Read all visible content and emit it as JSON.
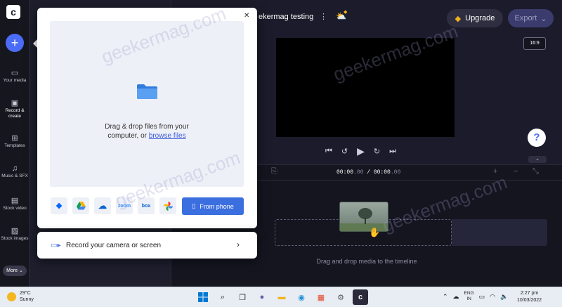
{
  "app": {
    "logo": "c",
    "project_name": "ekermag testing",
    "upgrade_label": "Upgrade",
    "export_label": "Export",
    "aspect_ratio": "16:9",
    "help": "?"
  },
  "sidebar": {
    "more_label": "More",
    "items": [
      {
        "label": "Your media",
        "icon": "folder-icon"
      },
      {
        "label": "Record & create",
        "icon": "camera-icon"
      },
      {
        "label": "Templates",
        "icon": "templates-icon"
      },
      {
        "label": "Music & SFX",
        "icon": "music-icon"
      },
      {
        "label": "Stock video",
        "icon": "film-icon"
      },
      {
        "label": "Stock images",
        "icon": "image-icon"
      }
    ]
  },
  "popup": {
    "drop_text": "Drag & drop files from your computer, or",
    "drop_line1": "Drag & drop files from your",
    "drop_line2": "computer, or",
    "browse_link": "browse files",
    "sources": [
      "dropbox",
      "google-drive",
      "onedrive",
      "zoom",
      "box",
      "google-photos"
    ],
    "zoom_label": "zoom",
    "box_label": "box",
    "from_phone_label": "From phone",
    "record_label": "Record your camera or screen"
  },
  "timeline": {
    "current_time": "00:00",
    "current_frac": ".00",
    "separator": " / ",
    "total_time": "00:00",
    "total_frac": ".00",
    "hint": "Drag and drop media to the timeline"
  },
  "watermark": "geekermag.com",
  "taskbar": {
    "temperature": "29°C",
    "condition": "Sunny",
    "language_top": "ENG",
    "language_bottom": "IN",
    "time": "2:27 pm",
    "date": "10/03/2022"
  }
}
